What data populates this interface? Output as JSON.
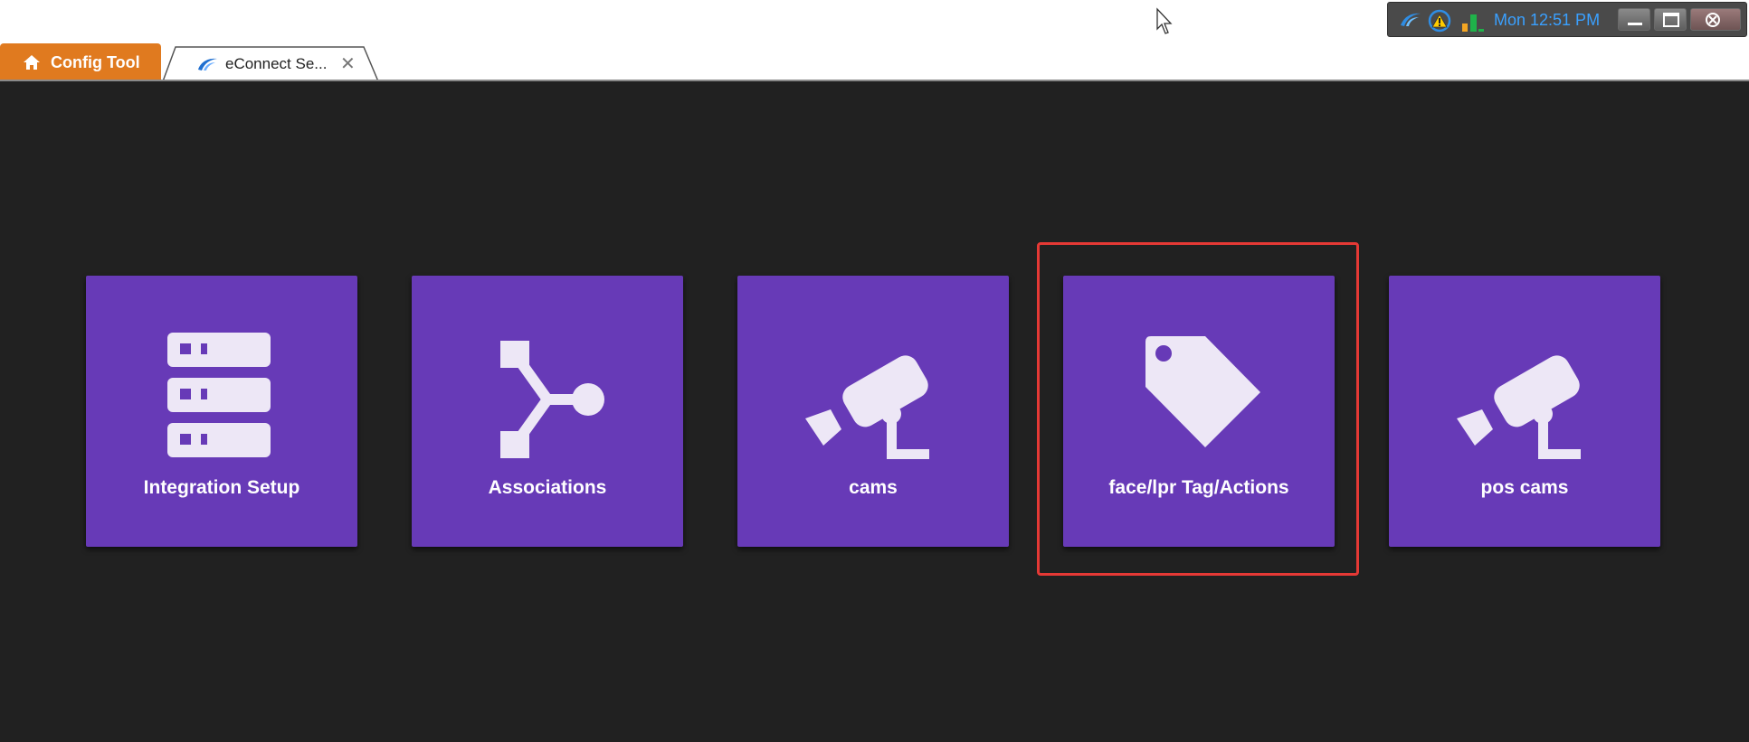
{
  "tabs": [
    {
      "label": "Config Tool",
      "icon": "home-icon",
      "color": "#e07a1f"
    },
    {
      "label": "eConnect Se...",
      "icon": "econnect-logo-icon",
      "close": "✕"
    }
  ],
  "tray": {
    "icons": [
      "econnect-logo-icon",
      "warning-icon",
      "signal-bars-icon"
    ],
    "clock": "Mon 12:51 PM",
    "window_buttons": [
      "minimize",
      "maximize",
      "close"
    ]
  },
  "tiles": [
    {
      "label": "Integration Setup",
      "icon": "server-stack-icon"
    },
    {
      "label": "Associations",
      "icon": "association-icon"
    },
    {
      "label": "cams",
      "icon": "camera-icon"
    },
    {
      "label": "face/lpr Tag/Actions",
      "icon": "tag-icon",
      "highlighted": true
    },
    {
      "label": "pos cams",
      "icon": "camera-icon"
    }
  ],
  "colors": {
    "tile_bg": "#673ab7",
    "icon_fill": "#ede7f6",
    "panel_bg": "#212121",
    "highlight": "#e53935",
    "clock": "#3aa0ff"
  }
}
